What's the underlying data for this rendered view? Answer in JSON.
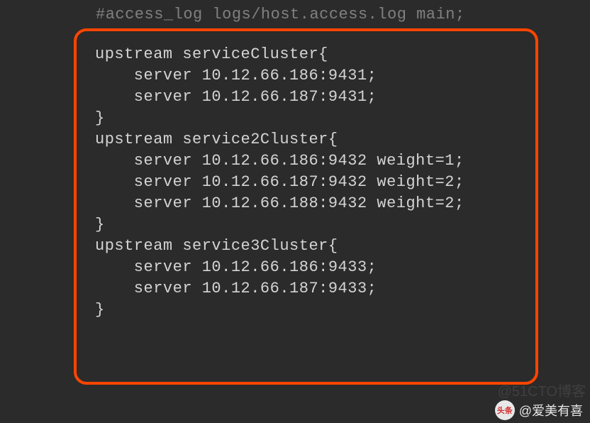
{
  "top_comment": "#access_log  logs/host.access.log  main;",
  "code": {
    "lines": [
      "upstream serviceCluster{",
      "    server 10.12.66.186:9431;",
      "    server 10.12.66.187:9431;",
      "}",
      "",
      "upstream service2Cluster{",
      "    server 10.12.66.186:9432 weight=1;",
      "    server 10.12.66.187:9432 weight=2;",
      "    server 10.12.66.188:9432 weight=2;",
      "}",
      "",
      "upstream service3Cluster{",
      "    server 10.12.66.186:9433;",
      "    server 10.12.66.187:9433;",
      "}"
    ]
  },
  "footer": {
    "icon_text": "头条",
    "username": "@爱美有喜"
  },
  "watermark": "@51CTO博客"
}
